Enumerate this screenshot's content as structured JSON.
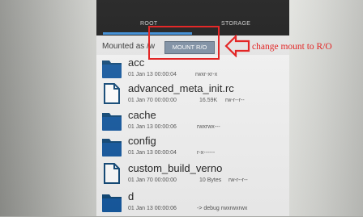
{
  "tabs": {
    "root_label": "ROOT",
    "storage_label": "STORAGE"
  },
  "path_bar": {
    "mounted_as": "Mounted as /w",
    "mount_button": "MOUNT R/O"
  },
  "annotation": {
    "text": "change mount to R/O",
    "color": "#e41818"
  },
  "colors": {
    "accent": "#3a8bd6",
    "folder": "#175aa0",
    "button": "#7d8fa3"
  },
  "files": [
    {
      "name": "acc",
      "type": "folder",
      "date": "01 Jan 13 00:00:04",
      "size": "",
      "perms": "rwxr-xr-x",
      "icon": "folder-icon"
    },
    {
      "name": "advanced_meta_init.rc",
      "type": "file",
      "date": "01 Jan 70 00:00:00",
      "size": "16.59K",
      "perms": "rw-r--r--",
      "icon": "file-icon"
    },
    {
      "name": "cache",
      "type": "folder",
      "date": "01 Jan 13 00:00:06",
      "size": "",
      "perms": "rwxrwx---",
      "icon": "folder-icon"
    },
    {
      "name": "config",
      "type": "folder",
      "date": "01 Jan 13 00:00:04",
      "size": "",
      "perms": "r-x------",
      "icon": "folder-icon"
    },
    {
      "name": "custom_build_verno",
      "type": "file",
      "date": "01 Jan 70 00:00:00",
      "size": "10 Bytes",
      "perms": "rw-r--r--",
      "icon": "file-icon"
    },
    {
      "name": "d",
      "type": "folder",
      "date": "01 Jan 13 00:00:06",
      "size": "",
      "perms": "-> debug  rwxrwxrwx",
      "icon": "folder-icon"
    }
  ]
}
